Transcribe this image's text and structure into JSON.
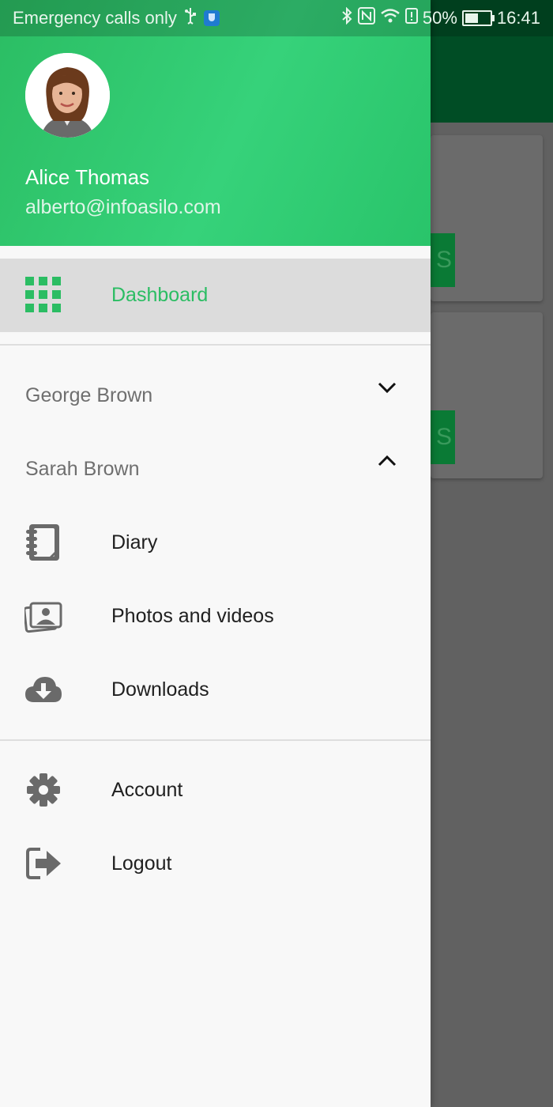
{
  "status_bar": {
    "carrier": "Emergency calls only",
    "battery": "50%",
    "time": "16:41"
  },
  "background_app": {
    "button_fragment": "S"
  },
  "drawer": {
    "user": {
      "name": "Alice Thomas",
      "email": "alberto@infoasilo.com"
    },
    "dashboard_label": "Dashboard",
    "groups": [
      {
        "label": "George Brown",
        "expanded": false
      },
      {
        "label": "Sarah Brown",
        "expanded": true
      }
    ],
    "sarah_items": [
      {
        "label": "Diary",
        "icon": "diary-icon"
      },
      {
        "label": "Photos and videos",
        "icon": "photos-icon"
      },
      {
        "label": "Downloads",
        "icon": "cloud-download-icon"
      }
    ],
    "footer_items": [
      {
        "label": "Account",
        "icon": "gear-icon"
      },
      {
        "label": "Logout",
        "icon": "logout-icon"
      }
    ]
  },
  "colors": {
    "accent": "#2bbd63",
    "header_gradient_start": "#2bbd63",
    "header_gradient_end": "#36d27a",
    "app_bar": "#004d25"
  }
}
